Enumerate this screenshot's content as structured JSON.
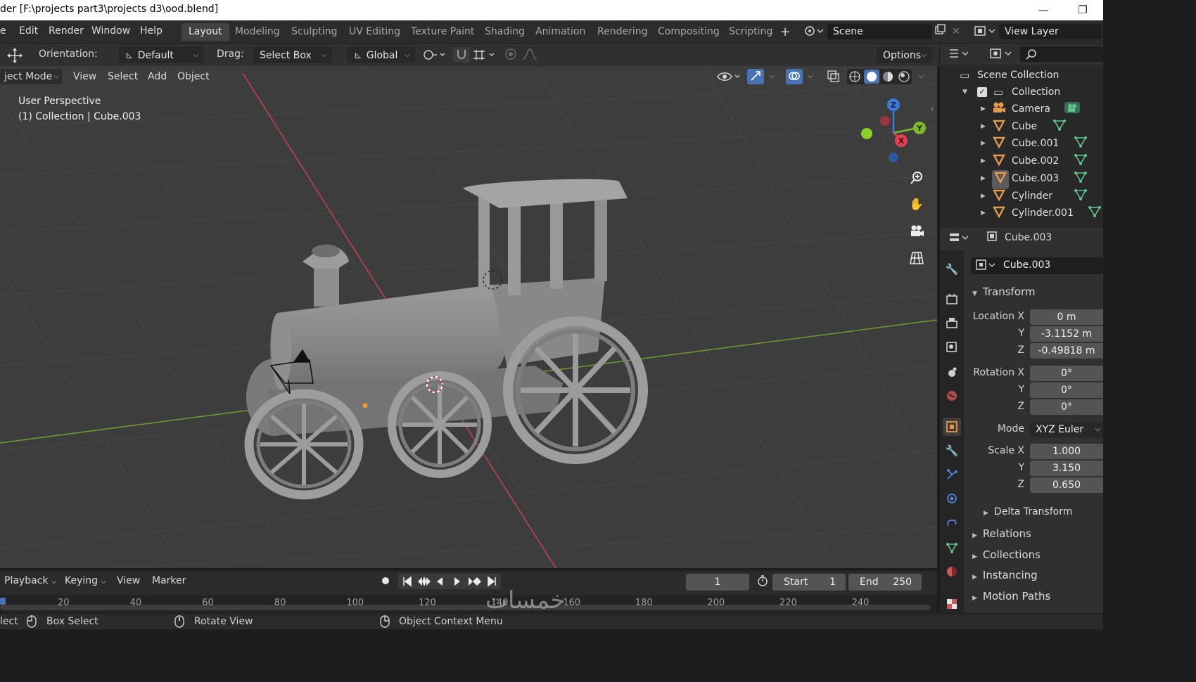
{
  "window": {
    "title": "der [F:\\projects part3\\projects d3\\ood.blend]",
    "minimize": "—",
    "maximize": "❐"
  },
  "menu": [
    "e",
    "Edit",
    "Render",
    "Window",
    "Help"
  ],
  "workspaces": [
    {
      "label": "Layout",
      "active": true
    },
    {
      "label": "Modeling"
    },
    {
      "label": "Sculpting"
    },
    {
      "label": "UV Editing"
    },
    {
      "label": "Texture Paint"
    },
    {
      "label": "Shading"
    },
    {
      "label": "Animation"
    },
    {
      "label": "Rendering"
    },
    {
      "label": "Compositing"
    },
    {
      "label": "Scripting"
    }
  ],
  "add_workspace": "+",
  "scene": {
    "label": "Scene"
  },
  "view_layer": {
    "label": "View Layer"
  },
  "toolbar": {
    "orientation_label": "Orientation:",
    "orientation_value": "Default",
    "drag_label": "Drag:",
    "drag_value": "Select Box",
    "transform_value": "Global",
    "options_label": "Options"
  },
  "viewport": {
    "mode": "ject Mode",
    "menus": [
      "View",
      "Select",
      "Add",
      "Object"
    ],
    "overlay_title": "User Perspective",
    "overlay_sub": "(1) Collection | Cube.003",
    "gizmo": {
      "z": "Z",
      "y": "Y",
      "x": "X"
    },
    "colors": {
      "x_axis": "#c7404b",
      "y_axis": "#6f9c2f",
      "grid": "#474747",
      "bg": "#3d3d3d",
      "model": "#8c8c8c"
    }
  },
  "outliner": {
    "root": "Scene Collection",
    "collection": "Collection",
    "items": [
      {
        "name": "Camera",
        "icon": "camera-icon"
      },
      {
        "name": "Cube",
        "icon": "mesh-icon"
      },
      {
        "name": "Cube.001",
        "icon": "mesh-icon"
      },
      {
        "name": "Cube.002",
        "icon": "mesh-icon"
      },
      {
        "name": "Cube.003",
        "icon": "mesh-icon",
        "selected": true
      },
      {
        "name": "Cylinder",
        "icon": "mesh-icon"
      },
      {
        "name": "Cylinder.001",
        "icon": "mesh-icon"
      }
    ]
  },
  "properties": {
    "header_object": "Cube.003",
    "object_name": "Cube.003",
    "transform_label": "Transform",
    "location": {
      "label_x": "Location X",
      "label_y": "Y",
      "label_z": "Z",
      "x": "0 m",
      "y": "-3.1152 m",
      "z": "-0.49818 m"
    },
    "rotation": {
      "label_x": "Rotation X",
      "label_y": "Y",
      "label_z": "Z",
      "x": "0°",
      "y": "0°",
      "z": "0°"
    },
    "mode": {
      "label": "Mode",
      "value": "XYZ Euler"
    },
    "scale": {
      "label_x": "Scale X",
      "label_y": "Y",
      "label_z": "Z",
      "x": "1.000",
      "y": "3.150",
      "z": "0.650"
    },
    "delta_transform": "Delta Transform",
    "sections": [
      "Relations",
      "Collections",
      "Instancing",
      "Motion Paths"
    ]
  },
  "timeline": {
    "menus": [
      "Playback",
      "Keying",
      "View",
      "Marker"
    ],
    "current_frame": "1",
    "start_label": "Start",
    "start_value": "1",
    "end_label": "End",
    "end_value": "250",
    "ticks": [
      "20",
      "40",
      "60",
      "80",
      "100",
      "120",
      "140",
      "160",
      "180",
      "200",
      "220",
      "240"
    ]
  },
  "statusbar": {
    "select": "lect",
    "box_select": "Box Select",
    "rotate_view": "Rotate View",
    "context_menu": "Object Context Menu"
  },
  "watermark": "خمسات"
}
